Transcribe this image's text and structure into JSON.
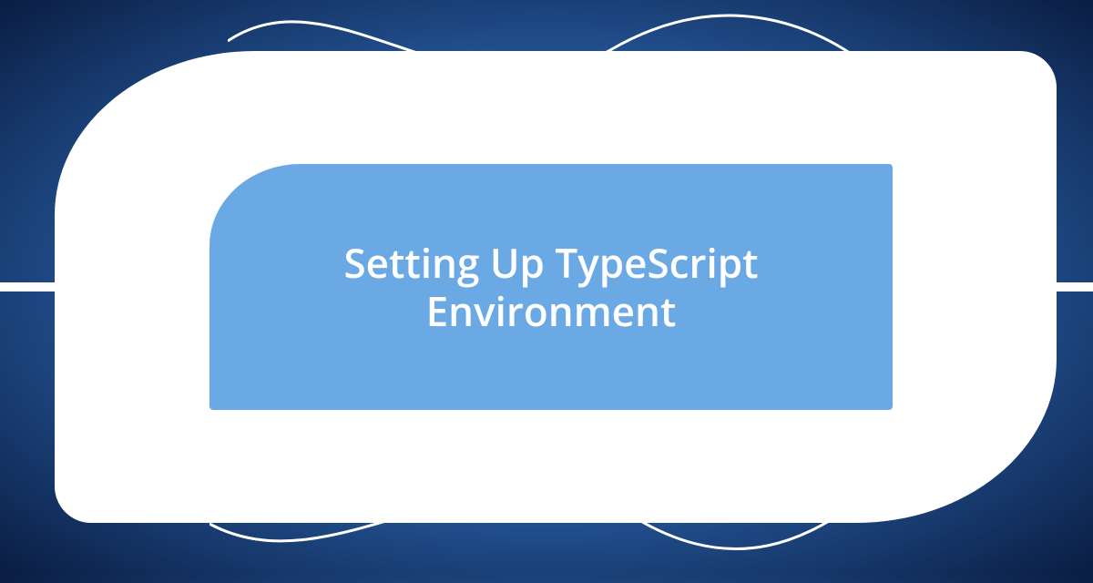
{
  "title": "Setting Up TypeScript Environment",
  "colors": {
    "panel": "#6aa9e4",
    "frame": "#ffffff",
    "bgCenter": "#5b9fe0",
    "bgEdge": "#0a1d42"
  }
}
